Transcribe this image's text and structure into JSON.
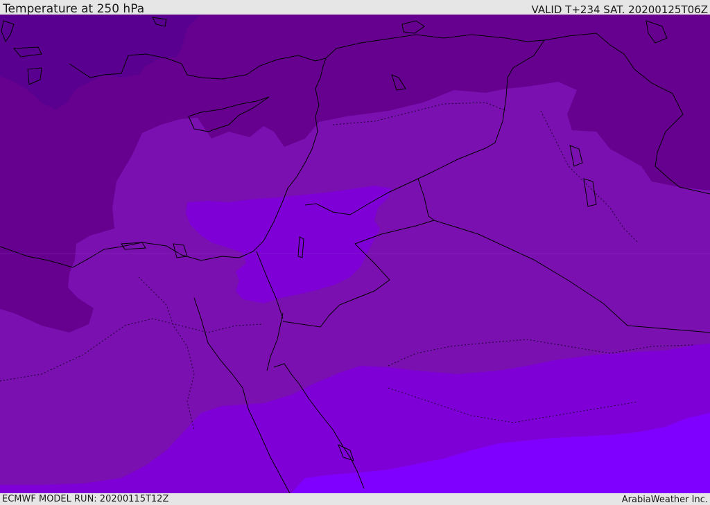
{
  "header": {
    "title": "Temperature at 250 hPa",
    "valid_time": "VALID T+234 SAT. 20200125T06Z"
  },
  "footer": {
    "model_run": "ECMWF MODEL RUN: 20200115T12Z",
    "credit": "ArabiaWeather Inc."
  },
  "map": {
    "variable": "temperature",
    "level": "250 hPa",
    "region": "Eastern Mediterranean / Middle East",
    "palette": {
      "coldest": "#5a0090",
      "cold": "#66008f",
      "mid": "#7a10b0",
      "warm": "#7e00d6",
      "warmest": "#8000ff",
      "coastline": "#000000",
      "border": "#000000"
    }
  }
}
